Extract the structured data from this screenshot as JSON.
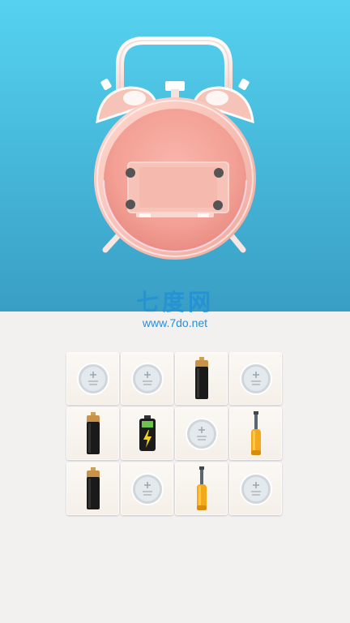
{
  "watermark": {
    "title": "七度网",
    "url": "www.7do.net"
  },
  "colors": {
    "sky_top": "#56d2f0",
    "sky_bottom": "#3a9ec4",
    "clock_body": "#f4b8ac",
    "clock_face": "#f5a39a",
    "tray_background": "#f2f1ef",
    "tile": "#f7f2ec"
  },
  "clock": {
    "state": "back-cover-removed",
    "screws_remaining": 4
  },
  "inventory": {
    "rows": 3,
    "columns": 4,
    "items": [
      {
        "type": "coin-cell",
        "icon": "coin-battery-icon"
      },
      {
        "type": "coin-cell",
        "icon": "coin-battery-icon"
      },
      {
        "type": "aa-battery",
        "icon": "aa-battery-icon"
      },
      {
        "type": "coin-cell",
        "icon": "coin-battery-icon"
      },
      {
        "type": "aa-battery",
        "icon": "aa-battery-icon"
      },
      {
        "type": "charged-battery",
        "icon": "charged-battery-icon"
      },
      {
        "type": "coin-cell",
        "icon": "coin-battery-icon"
      },
      {
        "type": "screwdriver",
        "icon": "screwdriver-icon"
      },
      {
        "type": "aa-battery",
        "icon": "aa-battery-icon"
      },
      {
        "type": "coin-cell",
        "icon": "coin-battery-icon"
      },
      {
        "type": "screwdriver",
        "icon": "screwdriver-icon"
      },
      {
        "type": "coin-cell",
        "icon": "coin-battery-icon"
      }
    ]
  }
}
